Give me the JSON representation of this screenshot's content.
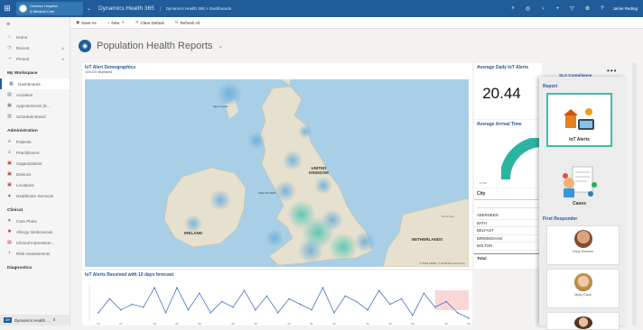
{
  "topbar": {
    "org_line1": "Contoso Hospital",
    "org_line2": "& Medical Care",
    "app_title": "Dynamics Health 365",
    "breadcrumb": "Dynamics Health 365  >  Dashboards",
    "user": "Jamie Reding",
    "icons": [
      "search-icon",
      "task-icon",
      "lightbulb-icon",
      "plus-icon",
      "filter-icon",
      "gear-icon",
      "help-icon"
    ]
  },
  "sidebar": {
    "top_items": [
      {
        "label": "Home",
        "icon": "home-icon"
      },
      {
        "label": "Recent",
        "icon": "clock-icon"
      },
      {
        "label": "Pinned",
        "icon": "pin-icon"
      }
    ],
    "workspace_heading": "My Workspace",
    "workspace_items": [
      {
        "label": "Dashboards",
        "icon": "dashboard-icon"
      },
      {
        "label": "Activities",
        "icon": "activity-icon"
      },
      {
        "label": "Appointments (E...",
        "icon": "calendar-icon"
      },
      {
        "label": "Schedule Board",
        "icon": "schedule-icon"
      }
    ],
    "admin_heading": "Administration",
    "admin_items": [
      {
        "label": "Patients",
        "icon": "person-icon"
      },
      {
        "label": "Practitioners",
        "icon": "person-icon"
      },
      {
        "label": "Organizations",
        "icon": "organization-icon"
      },
      {
        "label": "Devices",
        "icon": "device-icon"
      },
      {
        "label": "Locations",
        "icon": "location-icon"
      },
      {
        "label": "Healthcare Services",
        "icon": "service-icon"
      }
    ],
    "clinical_heading": "Clinical",
    "clinical_items": [
      {
        "label": "Care Plans",
        "icon": "heart-icon"
      },
      {
        "label": "Allergy Intolerances",
        "icon": "allergy-icon"
      },
      {
        "label": "Clinical Impression...",
        "icon": "impression-icon"
      },
      {
        "label": "Risk Assessments",
        "icon": "risk-icon"
      }
    ],
    "diagnostics_heading": "Diagnostics",
    "footer_badge": "DH",
    "footer_label": "Dynamics Health ..."
  },
  "commandbar": {
    "save_as": "Save As",
    "new": "New",
    "clear_default": "Clear Default",
    "refresh_all": "Refresh All"
  },
  "page": {
    "title": "Population Health Reports"
  },
  "map_panel": {
    "title": "IoT Alert Demographics",
    "subtitle": "110/110 displayed",
    "labels": {
      "isle_of_lewis": "Isle of Lewis",
      "uk": "UNITED\nKINGDOM",
      "isle_of_man": "ISLE OF MAN",
      "ireland": "IRELAND",
      "netherlands": "NETHERLANDS",
      "north_sea": "North Sea",
      "copyright": "© 2018 HERE, © 2018 Microsoft Corp"
    }
  },
  "line_panel": {
    "title": "IoT Alerts Received with 10 days forecast"
  },
  "chart_data": {
    "type": "line",
    "title": "IoT Alerts Received with 10 days forecast",
    "y_tick_labels": [
      "22",
      "21",
      "20",
      "21",
      "20",
      "20",
      "20",
      "21",
      "21",
      "20",
      "21",
      "20",
      "20",
      "20",
      "20"
    ],
    "values": [
      13,
      18,
      14,
      16,
      15,
      22,
      13,
      22,
      14,
      20,
      13,
      17,
      15,
      21,
      14,
      19,
      13,
      18,
      16,
      14,
      22,
      13,
      19,
      17,
      14,
      21,
      16,
      18,
      12,
      20,
      15,
      17,
      13,
      11
    ],
    "forecast_start_index": 30
  },
  "kpis": {
    "avg_daily_title": "Average Daily IoT Alerts",
    "avg_daily_value": "20.44",
    "avg_arrival_title": "Average Arrival Time",
    "gauge_min": "17:00",
    "sla_title": "SLA Compliance"
  },
  "city_table": {
    "header": "City",
    "rows": [
      "ABERDEEN",
      "BATH",
      "BELFAST",
      "BIRMINGHAM",
      "BOLTON"
    ],
    "total_label": "Total"
  },
  "report_panel": {
    "heading": "Report",
    "cards": [
      {
        "label": "IoT Alerts",
        "icon": "iot-alerts-icon",
        "selected": true
      },
      {
        "label": "Cases",
        "icon": "cases-icon",
        "selected": false
      }
    ],
    "first_responder_heading": "First Responder",
    "responders": [
      {
        "name": "Greg Winston"
      },
      {
        "name": "Molly Clark"
      }
    ]
  }
}
